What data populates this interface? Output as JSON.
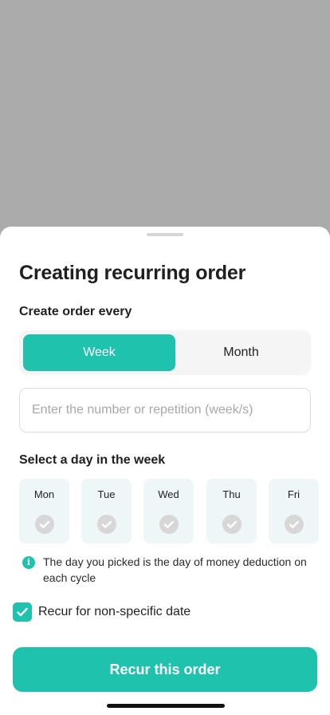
{
  "sheet": {
    "title": "Creating recurring order",
    "create_every_label": "Create order every",
    "period_options": [
      "Week",
      "Month"
    ],
    "selected_period": "Week",
    "repetition_input": {
      "value": "",
      "placeholder": "Enter the number or repetition (week/s)"
    },
    "day_section_label": "Select a day in the week",
    "days": [
      "Mon",
      "Tue",
      "Wed",
      "Thu",
      "Fri"
    ],
    "info_icon": "info-icon",
    "info_text": "The day you picked is the day of money deduction on each cycle",
    "recur_checkbox": {
      "label": "Recur for non-specific date",
      "checked": true
    },
    "submit_label": "Recur this order"
  },
  "colors": {
    "accent": "#1ec2ad",
    "backdrop": "#ababab",
    "day_tile": "#eef6f8",
    "check_inactive": "#d7d7d7"
  }
}
